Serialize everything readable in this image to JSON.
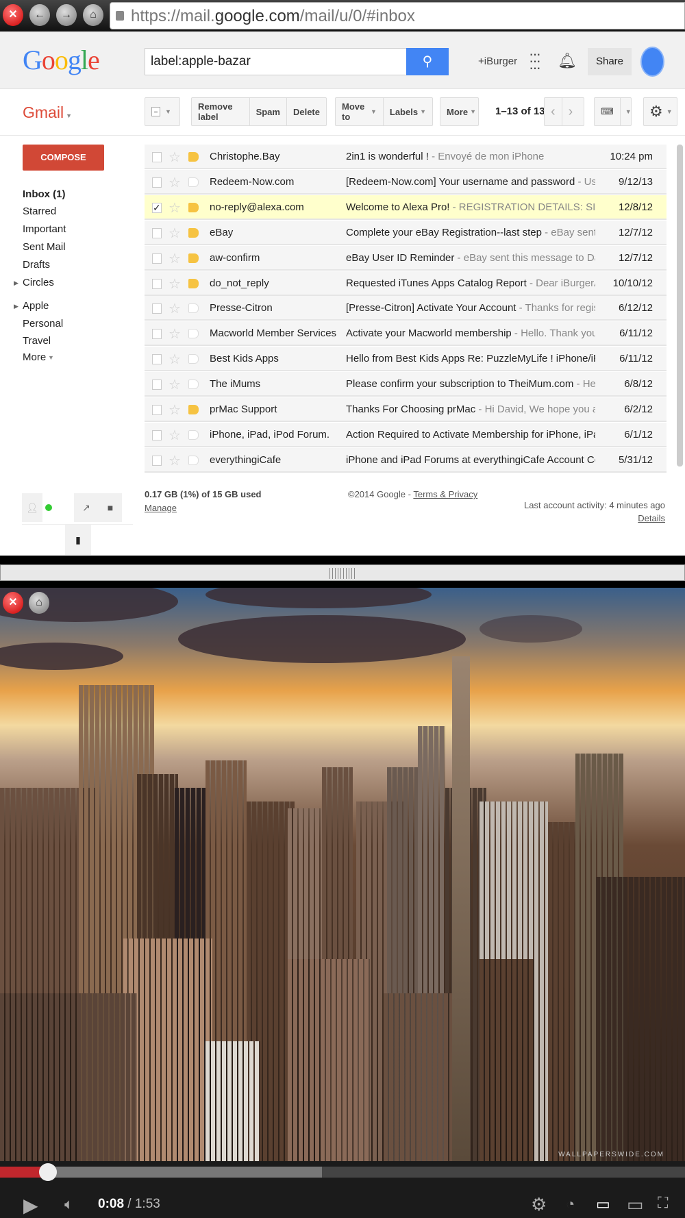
{
  "browser": {
    "url_prefix": "https://mail.",
    "url_domain": "google.com",
    "url_suffix": "/mail/u/0/#inbox"
  },
  "header": {
    "logo": "Google",
    "search_value": "label:apple-bazar",
    "user_link": "+iBurger",
    "share": "Share"
  },
  "toolbar": {
    "app": "Gmail",
    "remove_label": "Remove label",
    "spam": "Spam",
    "delete": "Delete",
    "move_to": "Move to",
    "labels": "Labels",
    "more": "More",
    "count": "1–13 of 13"
  },
  "sidebar": {
    "compose": "COMPOSE",
    "items": [
      {
        "label": "Inbox (1)"
      },
      {
        "label": "Starred"
      },
      {
        "label": "Important"
      },
      {
        "label": "Sent Mail"
      },
      {
        "label": "Drafts"
      },
      {
        "label": "Circles"
      },
      {
        "label": "Apple"
      },
      {
        "label": "Personal"
      },
      {
        "label": "Travel"
      },
      {
        "label": "More"
      }
    ]
  },
  "emails": [
    {
      "sender": "Christophe.Bay",
      "subject": "2in1 is wonderful !",
      "snippet": " - Envoyé de mon iPhone",
      "date": "10:24 pm",
      "label": true,
      "checked": false
    },
    {
      "sender": "Redeem-Now.com",
      "subject": "[Redeem-Now.com] Your username and password",
      "snippet": " - Usernar",
      "date": "9/12/13",
      "label": false,
      "checked": false
    },
    {
      "sender": "no-reply@alexa.com",
      "subject": "Welcome to Alexa Pro!",
      "snippet": " - REGISTRATION DETAILS: SIGN-U",
      "date": "12/8/12",
      "label": true,
      "checked": true
    },
    {
      "sender": "eBay",
      "subject": "Complete your eBay Registration--last step",
      "snippet": " - eBay sent this",
      "date": "12/7/12",
      "label": true,
      "checked": false
    },
    {
      "sender": "aw-confirm",
      "subject": "eBay User ID Reminder",
      "snippet": " - eBay sent this message to David I",
      "date": "12/7/12",
      "label": true,
      "checked": false
    },
    {
      "sender": "do_not_reply",
      "subject": "Requested iTunes Apps Catalog Report",
      "snippet": " - Dear iBurgerApps:",
      "date": "10/10/12",
      "label": true,
      "checked": false
    },
    {
      "sender": "Presse-Citron",
      "subject": "[Presse-Citron] Activate Your Account",
      "snippet": " - Thanks for registerin",
      "date": "6/12/12",
      "label": false,
      "checked": false
    },
    {
      "sender": "Macworld Member Services",
      "subject": "Activate your Macworld membership",
      "snippet": " - Hello. Thank you for r",
      "date": "6/11/12",
      "label": false,
      "checked": false
    },
    {
      "sender": "Best Kids Apps",
      "subject": "Hello from Best Kids Apps Re: PuzzleMyLife ! iPhone/iPad,",
      "snippet": "",
      "date": "6/11/12",
      "label": false,
      "checked": false
    },
    {
      "sender": "The iMums",
      "subject": "Please confirm your subscription to TheiMum.com",
      "snippet": " - Hello! T",
      "date": "6/8/12",
      "label": false,
      "checked": false
    },
    {
      "sender": "prMac Support",
      "subject": "Thanks For Choosing prMac",
      "snippet": " - Hi David, We hope you are ha",
      "date": "6/2/12",
      "label": true,
      "checked": false
    },
    {
      "sender": "iPhone, iPad, iPod Forum.",
      "subject": "Action Required to Activate Membership for iPhone, iPad, iP",
      "snippet": "",
      "date": "6/1/12",
      "label": false,
      "checked": false
    },
    {
      "sender": "everythingiCafe",
      "subject": "iPhone and iPad Forums at everythingiCafe Account Confirm",
      "snippet": "",
      "date": "5/31/12",
      "label": false,
      "checked": false
    }
  ],
  "footer": {
    "storage": "0.17 GB (1%) of 15 GB used",
    "manage": "Manage",
    "copyright": "©2014 Google - ",
    "terms": "Terms & Privacy",
    "activity": "Last account activity: 4 minutes ago",
    "details": "Details"
  },
  "video": {
    "current": "0:08",
    "duration": " / 1:53",
    "played_fraction": 0.07,
    "buffered_fraction": 0.47,
    "watermark": "WALLPAPERSWIDE.COM"
  }
}
